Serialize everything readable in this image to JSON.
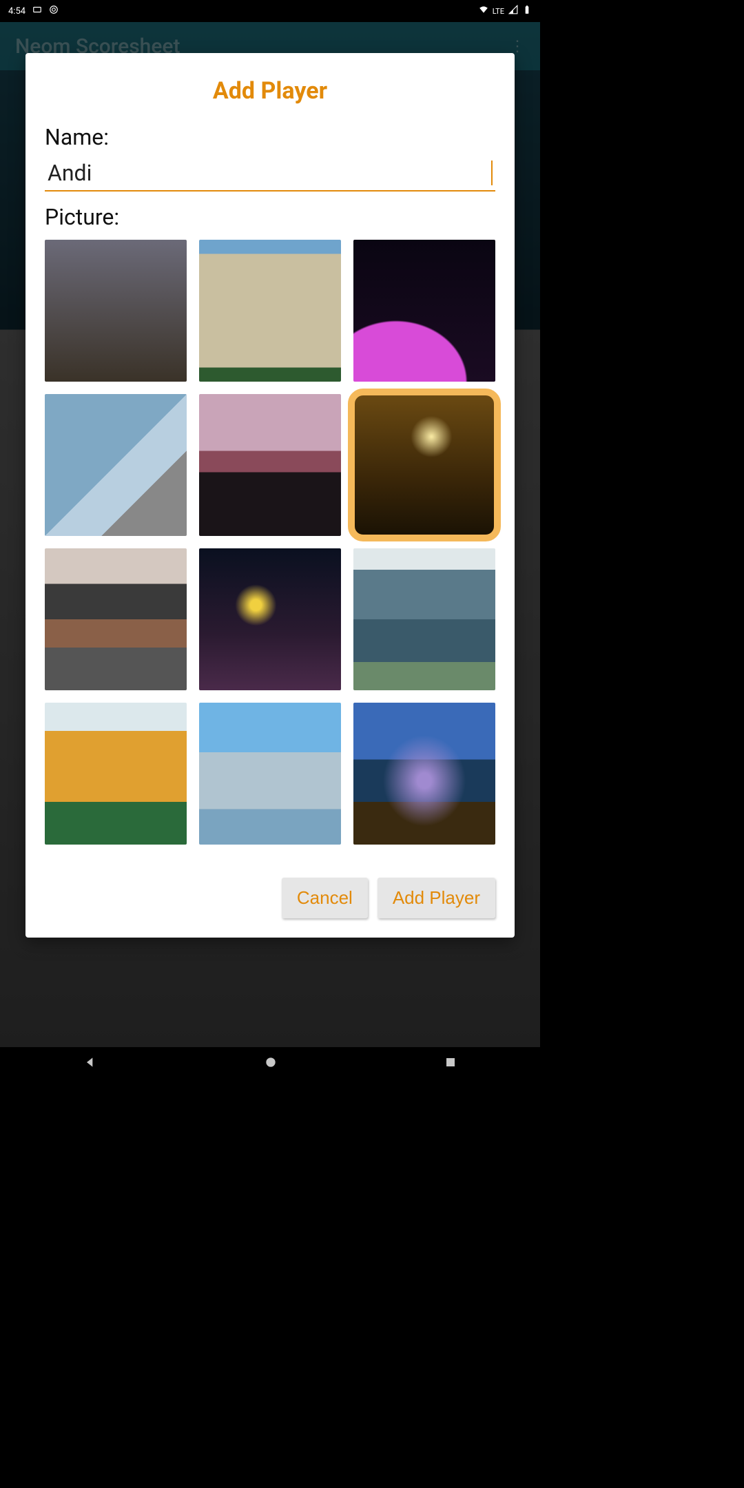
{
  "status": {
    "time": "4:54",
    "network_label": "LTE"
  },
  "app": {
    "title": "Neom Scoresheet"
  },
  "dialog": {
    "title": "Add Player",
    "name_label": "Name:",
    "name_value": "Andi",
    "picture_label": "Picture:",
    "selected_picture_index": 5,
    "pictures": [
      {
        "id": "pic-refinery-night"
      },
      {
        "id": "pic-curvy-building"
      },
      {
        "id": "pic-purple-bridge"
      },
      {
        "id": "pic-glass-mall"
      },
      {
        "id": "pic-pyramid-sunset"
      },
      {
        "id": "pic-eiffel-night"
      },
      {
        "id": "pic-frame-tower"
      },
      {
        "id": "pic-petrochem-night"
      },
      {
        "id": "pic-glass-office"
      },
      {
        "id": "pic-yellow-villa"
      },
      {
        "id": "pic-dome-arch"
      },
      {
        "id": "pic-resort-dusk"
      }
    ],
    "cancel_label": "Cancel",
    "confirm_label": "Add Player"
  }
}
